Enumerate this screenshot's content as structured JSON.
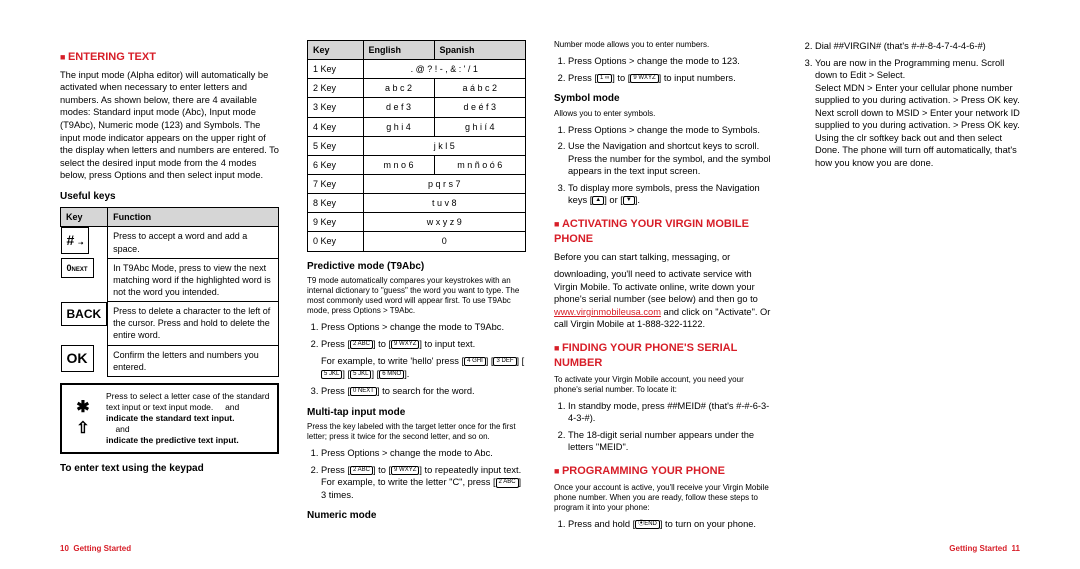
{
  "h_entering": "ENTERING TEXT",
  "p_entering": "The input mode (Alpha editor) will automatically be activated when necessary to enter letters and numbers. As shown below, there are 4 available modes: Standard input mode (Abc), Input mode (T9Abc), Numeric mode (123) and Symbols. The input mode indicator appears on the upper right of the display when letters and numbers are entered. To select the desired input mode from the 4 modes below, press Options and then select input mode.",
  "h_useful": "Useful keys",
  "tbl_useful": {
    "head": [
      "Key",
      "Function"
    ],
    "rows": [
      [
        "#",
        "Press to accept a word and add a space."
      ],
      [
        "0 NEXT",
        "In T9Abc Mode, press to view the next matching word if the highlighted word is not the word you intended."
      ],
      [
        "BACK",
        "Press to delete a character to the left of the cursor. Press and hold to delete the entire word."
      ],
      [
        "OK",
        "Confirm the letters and numbers you entered."
      ]
    ]
  },
  "box": {
    "sym": "✱ ⇧",
    "txt1": "Press to select a letter case of the standard text input or text input mode.",
    "txt_and1": "and",
    "txt2": "indicate the standard text input.",
    "txt_and2": "and",
    "txt3": "indicate the predictive text input."
  },
  "h_keypad": "To enter text using the keypad",
  "tbl_keypad": {
    "head": [
      "Key",
      "English",
      "Spanish"
    ],
    "rows": [
      [
        "1 Key",
        ". @ ? ! - , & : ' / 1",
        ""
      ],
      [
        "2 Key",
        "a b c 2",
        "a á b c 2"
      ],
      [
        "3 Key",
        "d e f 3",
        "d e é f 3"
      ],
      [
        "4 Key",
        "g h i 4",
        "g h i í 4"
      ],
      [
        "5 Key",
        "j k l 5",
        ""
      ],
      [
        "6 Key",
        "m n o 6",
        "m n ñ o ó 6"
      ],
      [
        "7 Key",
        "p q r s 7",
        ""
      ],
      [
        "8 Key",
        "t u v 8",
        ""
      ],
      [
        "9 Key",
        "w x y z 9",
        ""
      ],
      [
        "0 Key",
        "0",
        ""
      ]
    ]
  },
  "h_pred": "Predictive mode (T9Abc)",
  "p_pred": "T9 mode automatically compares your keystrokes with an internal dictionary to \"guess\" the word you want to type. The most commonly used word will appear first. To use T9Abc mode, press Options > T9Abc.",
  "pred_step1": "Press Options > change the mode to T9Abc.",
  "pred_step2_a": "Press [",
  "pred_step2_b": "] to [",
  "pred_step2_c": "] to input text.",
  "pred_example_a": "For example, to write 'hello' press [",
  "pred_example_b": "] [",
  "pred_example_c": "].",
  "pred_step3_a": "Press [",
  "pred_step3_b": "] to search for the word.",
  "h_multi": "Multi-tap input mode",
  "p_multi": "Press the key labeled with the target letter once for the first letter; press it twice for the second letter, and so on.",
  "multi_step1": "Press Options > change the mode to Abc.",
  "multi_step2_a": "Press [",
  "multi_step2_b": "] to [",
  "multi_step2_c": "] to repeatedly input text. For example, to write the letter \"C\", press [",
  "multi_step2_d": "] 3 times.",
  "h_num": "Numeric mode",
  "p_num": "Number mode allows you to enter numbers.",
  "num_step1": "Press Options > change the mode to 123.",
  "num_step2_a": "Press [",
  "num_step2_b": "] to [",
  "num_step2_c": "] to input numbers.",
  "h_sym": "Symbol mode",
  "p_sym": "Allows you to enter symbols.",
  "sym_step1": "Press Options > change the mode to Symbols.",
  "sym_step2": "Use the Navigation and shortcut keys to scroll. Press the number for the symbol, and the symbol appears in the text input screen.",
  "sym_step3_a": "To display more symbols, press the Navigation keys [",
  "sym_step3_b": "] or [",
  "sym_step3_c": "].",
  "h_act": "ACTIVATING YOUR VIRGIN MOBILE PHONE",
  "p_act1": "Before you can start talking, messaging, or",
  "p_act2_a": "downloading, you'll need to activate service with Virgin Mobile. To activate online, write down your phone's serial number (see below) and then go to ",
  "p_act2_link": "www.virginmobileusa.com",
  "p_act2_b": " and click on \"Activate\". Or call Virgin Mobile at 1-888-322-1122.",
  "h_serial": "FINDING YOUR PHONE'S SERIAL NUMBER",
  "p_serial": "To activate your Virgin Mobile account, you need your phone's serial number. To locate it:",
  "serial_step1": "In standby mode, press ##MEID# (that's #-#-6-3-4-3-#).",
  "serial_step2": "The 18-digit serial number appears under the letters \"MEID\".",
  "h_prog": "PROGRAMMING YOUR PHONE",
  "p_prog": "Once your account is active, you'll receive your Virgin Mobile phone number. When you are ready, follow these steps to program it into your phone:",
  "prog_step1_a": "Press and hold [",
  "prog_step1_b": "] to turn on your phone.",
  "prog_step2": "Dial ##VIRGIN# (that's #-#-8-4-7-4-4-6-#)",
  "prog_step3": "You are now in the Programming menu. Scroll down to Edit > Select.\nSelect MDN > Enter your cellular phone number supplied to you during activation. > Press OK key.\nNext scroll down to MSID > Enter your network ID supplied to you during activation. > Press OK key.\nUsing the clr softkey back out and then select Done. The phone will turn off automatically, that's how you know you are done.",
  "footer_left_pg": "10",
  "footer_left_txt": "Getting Started",
  "footer_right_txt": "Getting Started",
  "footer_right_pg": "11",
  "keycaps": {
    "k1": "1 ∞",
    "k2": "2 ABC",
    "k3": "3 DEF",
    "k4": "4 GHI",
    "k5": "5 JKL",
    "k6": "6 MNO",
    "k9": "9 WXYZ",
    "k0next": "0 NEXT",
    "end": "⦿END"
  }
}
